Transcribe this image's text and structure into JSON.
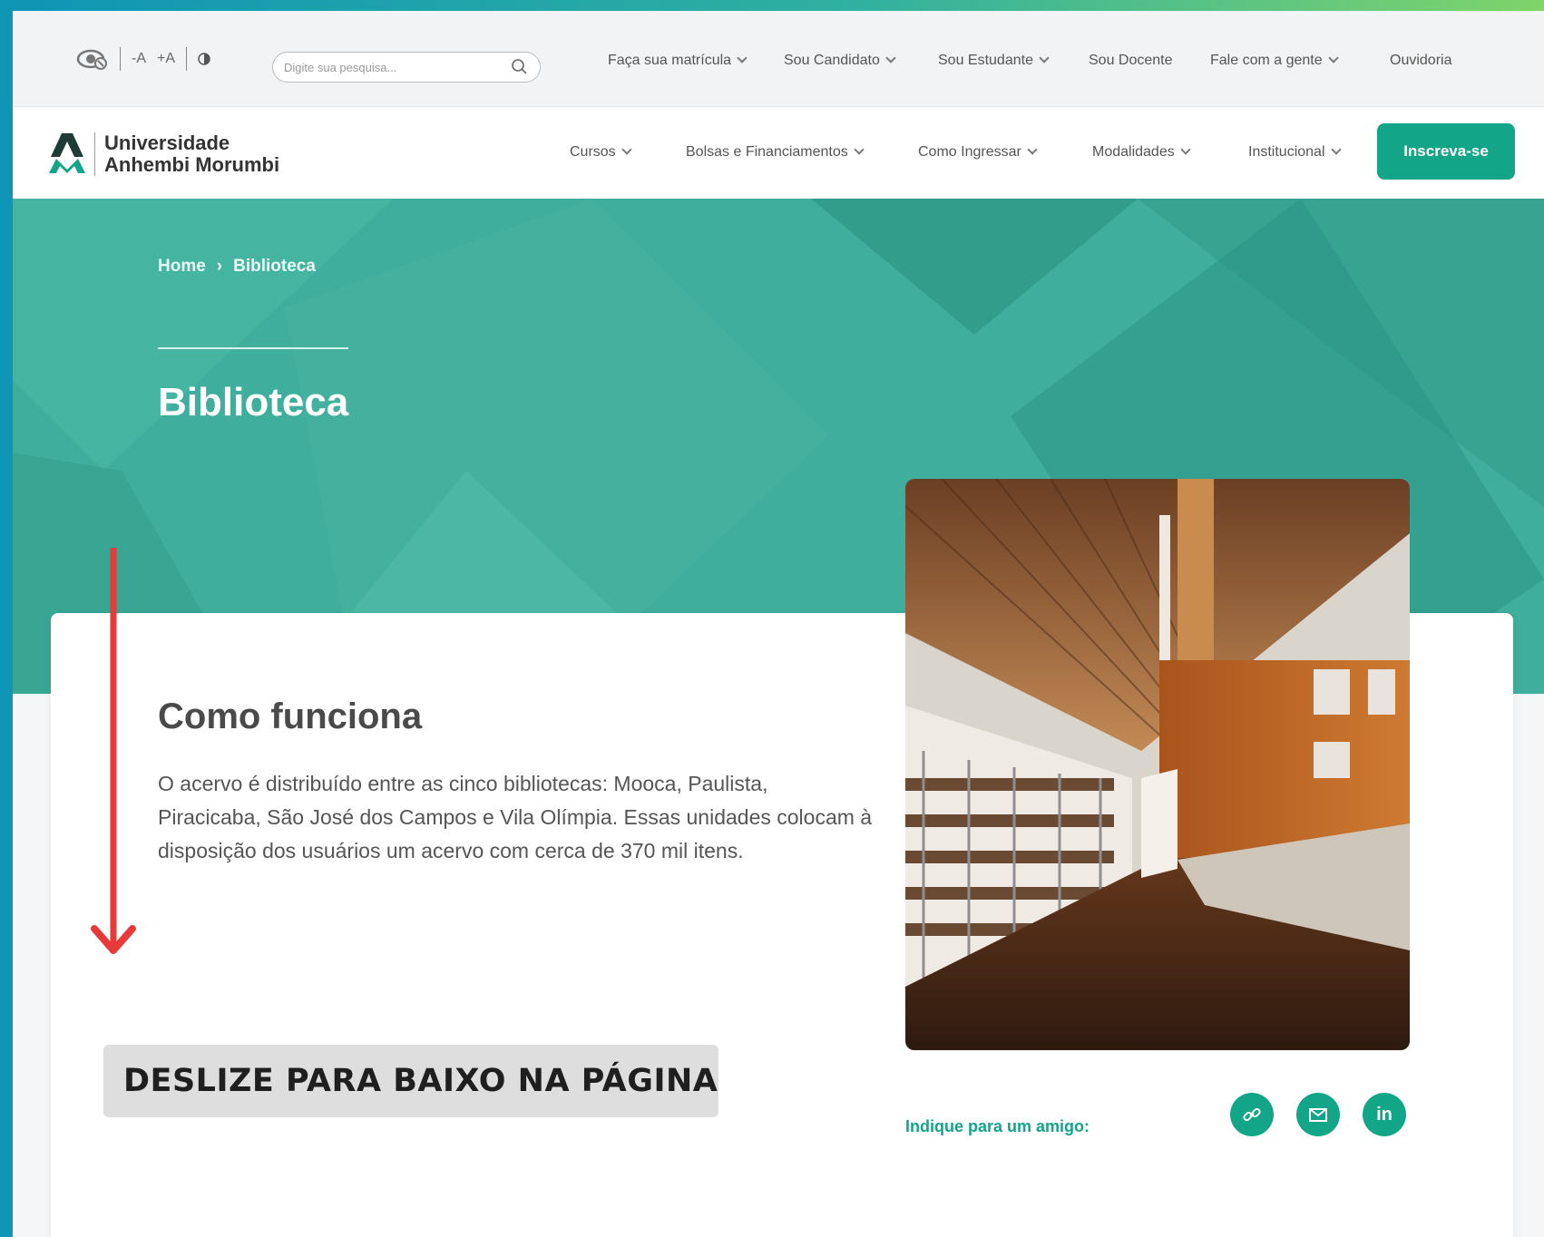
{
  "colors": {
    "brand": "#12a587",
    "hero": "#3fae9c",
    "frame_left": "#0f95b5",
    "frame_right": "#7fd46a",
    "annotation_arrow": "#e83a3a"
  },
  "utility": {
    "font_decrease": "-A",
    "font_increase": "+A",
    "contrast_icon": "contrast-icon",
    "accessibility_icon": "eye-icon",
    "search_placeholder": "Digite sua pesquisa...",
    "links": [
      "Faça sua matrícula",
      "Sou Candidato",
      "Sou Estudante",
      "Sou Docente",
      "Fale com a gente",
      "Ouvidoria"
    ],
    "has_dropdown": [
      true,
      true,
      true,
      false,
      true,
      false
    ]
  },
  "header": {
    "logo_line1": "Universidade",
    "logo_line2": "Anhembi Morumbi",
    "nav": [
      "Cursos",
      "Bolsas e Financiamentos",
      "Como Ingressar",
      "Modalidades",
      "Institucional"
    ],
    "cta": "Inscreva-se"
  },
  "hero": {
    "breadcrumb": [
      "Home",
      "Biblioteca"
    ],
    "breadcrumb_sep": "›",
    "title": "Biblioteca"
  },
  "content": {
    "heading": "Como funciona",
    "body": "O acervo é distribuído entre as cinco bibliotecas: Mooca, Paulista, Piracicaba, São José dos Campos e Vila Olímpia. Essas unidades colocam à disposição dos usuários um acervo com cerca de 370 mil itens.",
    "share_label": "Indique para um amigo:",
    "share_icons": [
      "link-icon",
      "mail-icon",
      "linkedin-icon"
    ],
    "linkedin_glyph": "in"
  },
  "annotation": {
    "text": "DESLIZE PARA BAIXO NA PÁGINA"
  }
}
